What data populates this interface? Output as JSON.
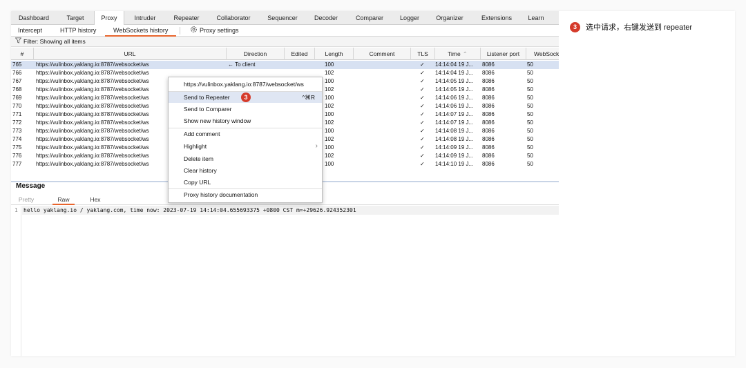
{
  "top_tabs": [
    "Dashboard",
    "Target",
    "Proxy",
    "Intruder",
    "Repeater",
    "Collaborator",
    "Sequencer",
    "Decoder",
    "Comparer",
    "Logger",
    "Organizer",
    "Extensions",
    "Learn"
  ],
  "active_top_tab": "Proxy",
  "sub_tabs": [
    "Intercept",
    "HTTP history",
    "WebSockets history"
  ],
  "active_sub_tab": "WebSockets history",
  "proxy_settings_label": "Proxy settings",
  "filter_label": "Filter: Showing all items",
  "columns": [
    "#",
    "URL",
    "Direction",
    "Edited",
    "Length",
    "Comment",
    "TLS",
    "Time",
    "Listener port",
    "WebSocket ID"
  ],
  "rows": [
    {
      "id": "765",
      "url": "https://vulinbox.yaklang.io:8787/websocket/ws",
      "direction": "← To client",
      "length": "100",
      "tls": "✓",
      "time": "14:14:04 19 J...",
      "port": "8086",
      "wsid": "50"
    },
    {
      "id": "766",
      "url": "https://vulinbox.yaklang.io:8787/websocket/ws",
      "direction": "",
      "length": "102",
      "tls": "✓",
      "time": "14:14:04 19 J...",
      "port": "8086",
      "wsid": "50"
    },
    {
      "id": "767",
      "url": "https://vulinbox.yaklang.io:8787/websocket/ws",
      "direction": "",
      "length": "100",
      "tls": "✓",
      "time": "14:14:05 19 J...",
      "port": "8086",
      "wsid": "50"
    },
    {
      "id": "768",
      "url": "https://vulinbox.yaklang.io:8787/websocket/ws",
      "direction": "",
      "length": "102",
      "tls": "✓",
      "time": "14:14:05 19 J...",
      "port": "8086",
      "wsid": "50"
    },
    {
      "id": "769",
      "url": "https://vulinbox.yaklang.io:8787/websocket/ws",
      "direction": "",
      "length": "100",
      "tls": "✓",
      "time": "14:14:06 19 J...",
      "port": "8086",
      "wsid": "50"
    },
    {
      "id": "770",
      "url": "https://vulinbox.yaklang.io:8787/websocket/ws",
      "direction": "",
      "length": "102",
      "tls": "✓",
      "time": "14:14:06 19 J...",
      "port": "8086",
      "wsid": "50"
    },
    {
      "id": "771",
      "url": "https://vulinbox.yaklang.io:8787/websocket/ws",
      "direction": "",
      "length": "100",
      "tls": "✓",
      "time": "14:14:07 19 J...",
      "port": "8086",
      "wsid": "50"
    },
    {
      "id": "772",
      "url": "https://vulinbox.yaklang.io:8787/websocket/ws",
      "direction": "",
      "length": "102",
      "tls": "✓",
      "time": "14:14:07 19 J...",
      "port": "8086",
      "wsid": "50"
    },
    {
      "id": "773",
      "url": "https://vulinbox.yaklang.io:8787/websocket/ws",
      "direction": "",
      "length": "100",
      "tls": "✓",
      "time": "14:14:08 19 J...",
      "port": "8086",
      "wsid": "50"
    },
    {
      "id": "774",
      "url": "https://vulinbox.yaklang.io:8787/websocket/ws",
      "direction": "",
      "length": "102",
      "tls": "✓",
      "time": "14:14:08 19 J...",
      "port": "8086",
      "wsid": "50"
    },
    {
      "id": "775",
      "url": "https://vulinbox.yaklang.io:8787/websocket/ws",
      "direction": "",
      "length": "100",
      "tls": "✓",
      "time": "14:14:09 19 J...",
      "port": "8086",
      "wsid": "50"
    },
    {
      "id": "776",
      "url": "https://vulinbox.yaklang.io:8787/websocket/ws",
      "direction": "",
      "length": "102",
      "tls": "✓",
      "time": "14:14:09 19 J...",
      "port": "8086",
      "wsid": "50"
    },
    {
      "id": "777",
      "url": "https://vulinbox.yaklang.io:8787/websocket/ws",
      "direction": "",
      "length": "100",
      "tls": "✓",
      "time": "14:14:10 19 J...",
      "port": "8086",
      "wsid": "50"
    }
  ],
  "message": {
    "title": "Message",
    "tabs": [
      "Pretty",
      "Raw",
      "Hex"
    ],
    "active_tab": "Raw",
    "line_number": "1",
    "content": "hello yaklang.io / yaklang.com, time now: 2023-07-19 14:14:04.655693375 +0800 CST m=+29626.924352301"
  },
  "context_menu": {
    "url": "https://vulinbox.yaklang.io:8787/websocket/ws",
    "send_to_repeater": "Send to Repeater",
    "send_to_repeater_shortcut": "^⌘R",
    "send_to_comparer": "Send to Comparer",
    "show_new_history_window": "Show new history window",
    "add_comment": "Add comment",
    "highlight": "Highlight",
    "delete_item": "Delete item",
    "clear_history": "Clear history",
    "copy_url": "Copy URL",
    "documentation": "Proxy history documentation",
    "step_badge": "3"
  },
  "annotation": {
    "badge": "3",
    "text": "选中请求，右键发送到 repeater"
  },
  "colors": {
    "accent": "#e8642c",
    "selection": "#d7e1f2",
    "badge": "#d53b2b"
  }
}
